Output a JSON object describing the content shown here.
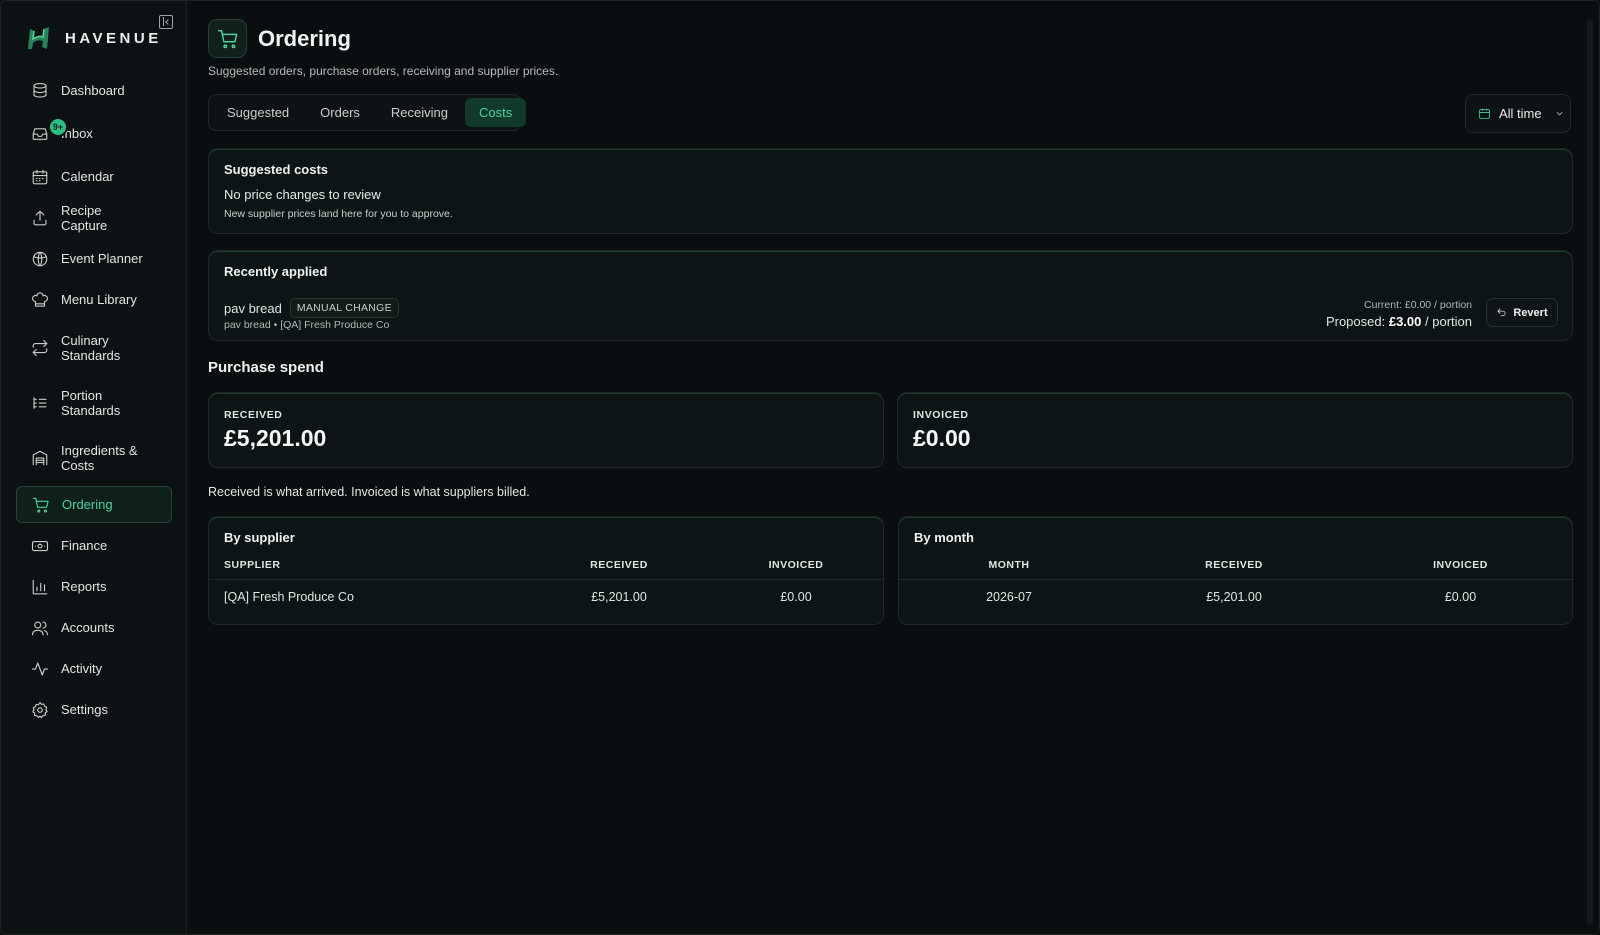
{
  "brand": {
    "name": "HAVENUE"
  },
  "sidebar": {
    "items": [
      {
        "label": "Dashboard",
        "icon": "database-icon"
      },
      {
        "label": "Inbox",
        "icon": "inbox-icon",
        "badge": "9+"
      },
      {
        "label": "Calendar",
        "icon": "calendar-icon"
      },
      {
        "label": "Recipe Capture",
        "icon": "upload-icon"
      },
      {
        "label": "Event Planner",
        "icon": "globe-icon"
      },
      {
        "label": "Menu Library",
        "icon": "chef-hat-icon"
      },
      {
        "label": "Culinary Standards",
        "icon": "repeat-icon"
      },
      {
        "label": "Portion Standards",
        "icon": "list-icon"
      },
      {
        "label": "Ingredients & Costs",
        "icon": "warehouse-icon"
      },
      {
        "label": "Ordering",
        "icon": "cart-icon",
        "active": true
      },
      {
        "label": "Finance",
        "icon": "banknote-icon"
      },
      {
        "label": "Reports",
        "icon": "bar-chart-icon"
      },
      {
        "label": "Accounts",
        "icon": "users-icon"
      },
      {
        "label": "Activity",
        "icon": "activity-icon"
      },
      {
        "label": "Settings",
        "icon": "gear-icon"
      }
    ]
  },
  "header": {
    "title": "Ordering",
    "subtitle": "Suggested orders, purchase orders, receiving and supplier prices."
  },
  "tabs": [
    {
      "label": "Suggested"
    },
    {
      "label": "Orders"
    },
    {
      "label": "Receiving"
    },
    {
      "label": "Costs",
      "active": true
    }
  ],
  "range": {
    "label": "All time"
  },
  "suggested_costs": {
    "title": "Suggested costs",
    "message": "No price changes to review",
    "note": "New supplier prices land here for you to approve."
  },
  "recently_applied": {
    "title": "Recently applied",
    "item_name": "pav bread",
    "item_chip": "MANUAL CHANGE",
    "item_sub": "pav bread • [QA] Fresh Produce Co",
    "current": "Current: £0.00 / portion",
    "proposed_prefix": "Proposed:",
    "proposed_value": "£3.00",
    "proposed_suffix": "/ portion",
    "revert_label": "Revert"
  },
  "purchase_spend": {
    "title": "Purchase spend",
    "received_label": "RECEIVED",
    "received_value": "£5,201.00",
    "invoiced_label": "INVOICED",
    "invoiced_value": "£0.00",
    "note": "Received is what arrived. Invoiced is what suppliers billed."
  },
  "by_supplier": {
    "title": "By supplier",
    "headers": [
      "SUPPLIER",
      "RECEIVED",
      "INVOICED"
    ],
    "rows": [
      [
        "[QA] Fresh Produce Co",
        "£5,201.00",
        "£0.00"
      ]
    ]
  },
  "by_month": {
    "title": "By month",
    "headers": [
      "MONTH",
      "RECEIVED",
      "INVOICED"
    ],
    "rows": [
      [
        "2026-07",
        "£5,201.00",
        "£0.00"
      ]
    ]
  },
  "colors": {
    "accent": "#4fd29b",
    "background": "#0a0e10"
  }
}
